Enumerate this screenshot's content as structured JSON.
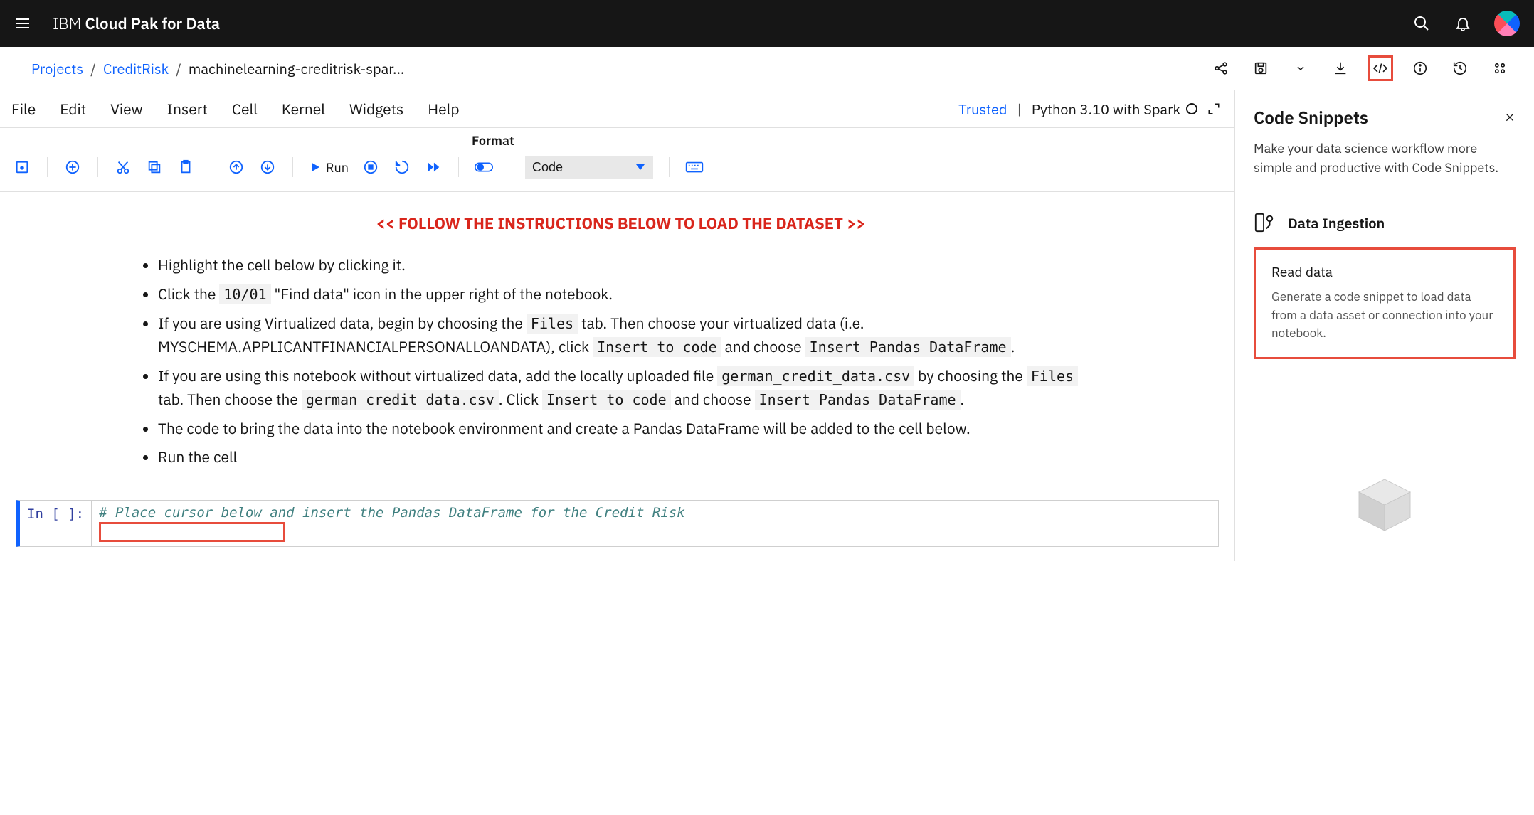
{
  "header": {
    "brand_prefix": "IBM ",
    "brand_main": "Cloud Pak for Data"
  },
  "breadcrumb": {
    "root": "Projects",
    "project": "CreditRisk",
    "current": "machinelearning-creditrisk-spar..."
  },
  "notebook": {
    "menu": [
      "File",
      "Edit",
      "View",
      "Insert",
      "Cell",
      "Kernel",
      "Widgets",
      "Help"
    ],
    "trusted": "Trusted",
    "kernel": "Python 3.10 with Spark",
    "format_label": "Format",
    "run_label": "Run",
    "cell_type": "Code",
    "instructions_header": "<< FOLLOW THE INSTRUCTIONS BELOW TO LOAD THE DATASET >>",
    "bullets": {
      "b1": "Highlight the cell below by clicking it.",
      "b2_a": "Click the ",
      "b2_code": "10/01",
      "b2_b": " \"Find data\" icon in the upper right of the notebook.",
      "b3_a": "If you are using Virtualized data, begin by choosing the ",
      "b3_files": "Files",
      "b3_b": " tab. Then choose your virtualized data (i.e. MYSCHEMA.APPLICANTFINANCIALPERSONALLOANDATA), click ",
      "b3_insert_code": "Insert to code",
      "b3_c": " and choose ",
      "b3_pandas": "Insert Pandas DataFrame",
      "b3_d": ".",
      "b4_a": "If you are using this notebook without virtualized data, add the locally uploaded file ",
      "b4_csv1": "german_credit_data.csv",
      "b4_b": " by choosing the ",
      "b4_files": "Files",
      "b4_c": " tab. Then choose the ",
      "b4_csv2": "german_credit_data.csv",
      "b4_d": ". Click ",
      "b4_insert_code": "Insert to code",
      "b4_e": " and choose ",
      "b4_pandas": "Insert Pandas DataFrame",
      "b4_f": ".",
      "b5": "The code to bring the data into the notebook environment and create a Pandas DataFrame will be added to the cell below.",
      "b6": "Run the cell"
    },
    "code_prompt": "In [ ]:",
    "code_comment": "# Place cursor below and insert the Pandas DataFrame for the Credit Risk"
  },
  "panel": {
    "title": "Code Snippets",
    "desc": "Make your data science workflow more simple and productive with Code Snippets.",
    "section": "Data Ingestion",
    "snippet_title": "Read data",
    "snippet_desc": "Generate a code snippet to load data from a data asset or connection into your notebook."
  }
}
